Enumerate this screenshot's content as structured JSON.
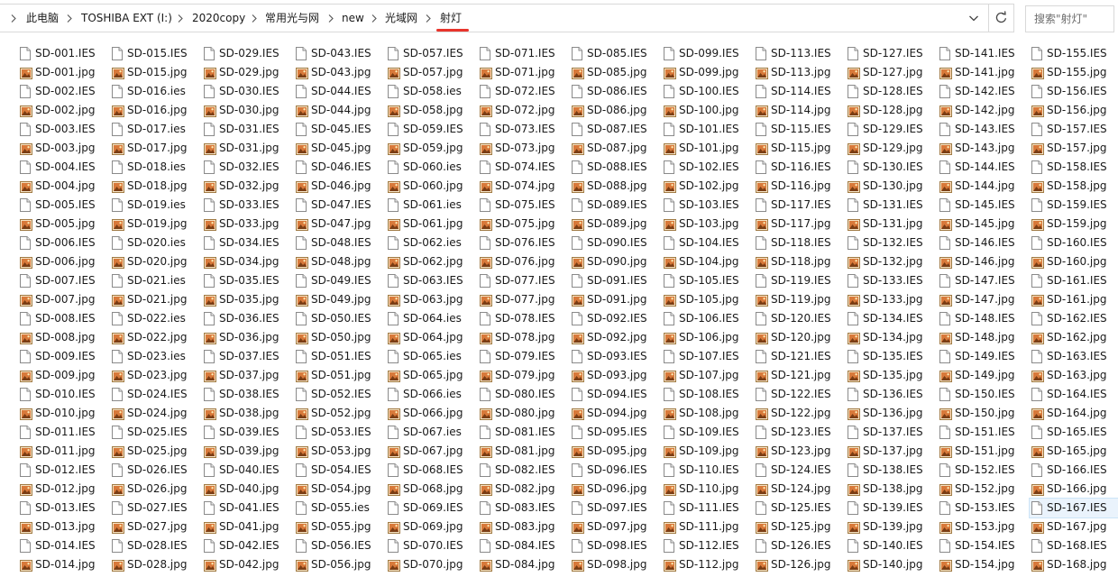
{
  "address_bar": {
    "breadcrumbs": [
      "此电脑",
      "TOSHIBA EXT (I:)",
      "2020copy",
      "常用光与网",
      "new",
      "光域网",
      "射灯"
    ]
  },
  "search": {
    "placeholder": "搜索\"射灯\""
  },
  "icons": {
    "address_dropdown": "chevron-down-icon",
    "refresh": "refresh-icon",
    "ies_file": "generic-file-icon",
    "jpg_file": "image-file-icon"
  },
  "colors": {
    "accent_underline": "#e8342c",
    "selection": "#eaf3fc"
  },
  "selected_file": "SD-167.IES",
  "files": {
    "columns": [
      [
        "SD-001.IES",
        "SD-001.jpg",
        "SD-002.IES",
        "SD-002.jpg",
        "SD-003.IES",
        "SD-003.jpg",
        "SD-004.IES",
        "SD-004.jpg",
        "SD-005.IES",
        "SD-005.jpg",
        "SD-006.IES",
        "SD-006.jpg",
        "SD-007.IES",
        "SD-007.jpg",
        "SD-008.IES",
        "SD-008.jpg",
        "SD-009.IES",
        "SD-009.jpg",
        "SD-010.IES",
        "SD-010.jpg",
        "SD-011.IES",
        "SD-011.jpg",
        "SD-012.IES",
        "SD-012.jpg",
        "SD-013.IES",
        "SD-013.jpg",
        "SD-014.IES",
        "SD-014.jpg"
      ],
      [
        "SD-015.IES",
        "SD-015.jpg",
        "SD-016.ies",
        "SD-016.jpg",
        "SD-017.ies",
        "SD-017.jpg",
        "SD-018.ies",
        "SD-018.jpg",
        "SD-019.ies",
        "SD-019.jpg",
        "SD-020.ies",
        "SD-020.jpg",
        "SD-021.ies",
        "SD-021.jpg",
        "SD-022.ies",
        "SD-022.jpg",
        "SD-023.ies",
        "SD-023.jpg",
        "SD-024.IES",
        "SD-024.jpg",
        "SD-025.IES",
        "SD-025.jpg",
        "SD-026.IES",
        "SD-026.jpg",
        "SD-027.IES",
        "SD-027.jpg",
        "SD-028.IES",
        "SD-028.jpg"
      ],
      [
        "SD-029.IES",
        "SD-029.jpg",
        "SD-030.IES",
        "SD-030.jpg",
        "SD-031.IES",
        "SD-031.jpg",
        "SD-032.IES",
        "SD-032.jpg",
        "SD-033.IES",
        "SD-033.jpg",
        "SD-034.IES",
        "SD-034.jpg",
        "SD-035.IES",
        "SD-035.jpg",
        "SD-036.IES",
        "SD-036.jpg",
        "SD-037.IES",
        "SD-037.jpg",
        "SD-038.IES",
        "SD-038.jpg",
        "SD-039.IES",
        "SD-039.jpg",
        "SD-040.IES",
        "SD-040.jpg",
        "SD-041.IES",
        "SD-041.jpg",
        "SD-042.IES",
        "SD-042.jpg"
      ],
      [
        "SD-043.IES",
        "SD-043.jpg",
        "SD-044.IES",
        "SD-044.jpg",
        "SD-045.IES",
        "SD-045.jpg",
        "SD-046.IES",
        "SD-046.jpg",
        "SD-047.IES",
        "SD-047.jpg",
        "SD-048.IES",
        "SD-048.jpg",
        "SD-049.IES",
        "SD-049.jpg",
        "SD-050.IES",
        "SD-050.jpg",
        "SD-051.IES",
        "SD-051.jpg",
        "SD-052.IES",
        "SD-052.jpg",
        "SD-053.IES",
        "SD-053.jpg",
        "SD-054.IES",
        "SD-054.jpg",
        "SD-055.ies",
        "SD-055.jpg",
        "SD-056.IES",
        "SD-056.jpg"
      ],
      [
        "SD-057.IES",
        "SD-057.jpg",
        "SD-058.ies",
        "SD-058.jpg",
        "SD-059.IES",
        "SD-059.jpg",
        "SD-060.ies",
        "SD-060.jpg",
        "SD-061.ies",
        "SD-061.jpg",
        "SD-062.ies",
        "SD-062.jpg",
        "SD-063.IES",
        "SD-063.jpg",
        "SD-064.ies",
        "SD-064.jpg",
        "SD-065.ies",
        "SD-065.jpg",
        "SD-066.ies",
        "SD-066.jpg",
        "SD-067.ies",
        "SD-067.jpg",
        "SD-068.IES",
        "SD-068.jpg",
        "SD-069.IES",
        "SD-069.jpg",
        "SD-070.IES",
        "SD-070.jpg"
      ],
      [
        "SD-071.IES",
        "SD-071.jpg",
        "SD-072.IES",
        "SD-072.jpg",
        "SD-073.IES",
        "SD-073.jpg",
        "SD-074.IES",
        "SD-074.jpg",
        "SD-075.IES",
        "SD-075.jpg",
        "SD-076.IES",
        "SD-076.jpg",
        "SD-077.IES",
        "SD-077.jpg",
        "SD-078.IES",
        "SD-078.jpg",
        "SD-079.IES",
        "SD-079.jpg",
        "SD-080.IES",
        "SD-080.jpg",
        "SD-081.IES",
        "SD-081.jpg",
        "SD-082.IES",
        "SD-082.jpg",
        "SD-083.IES",
        "SD-083.jpg",
        "SD-084.IES",
        "SD-084.jpg"
      ],
      [
        "SD-085.IES",
        "SD-085.jpg",
        "SD-086.IES",
        "SD-086.jpg",
        "SD-087.IES",
        "SD-087.jpg",
        "SD-088.IES",
        "SD-088.jpg",
        "SD-089.IES",
        "SD-089.jpg",
        "SD-090.IES",
        "SD-090.jpg",
        "SD-091.IES",
        "SD-091.jpg",
        "SD-092.IES",
        "SD-092.jpg",
        "SD-093.IES",
        "SD-093.jpg",
        "SD-094.IES",
        "SD-094.jpg",
        "SD-095.IES",
        "SD-095.jpg",
        "SD-096.IES",
        "SD-096.jpg",
        "SD-097.IES",
        "SD-097.jpg",
        "SD-098.IES",
        "SD-098.jpg"
      ],
      [
        "SD-099.IES",
        "SD-099.jpg",
        "SD-100.IES",
        "SD-100.jpg",
        "SD-101.IES",
        "SD-101.jpg",
        "SD-102.IES",
        "SD-102.jpg",
        "SD-103.IES",
        "SD-103.jpg",
        "SD-104.IES",
        "SD-104.jpg",
        "SD-105.IES",
        "SD-105.jpg",
        "SD-106.IES",
        "SD-106.jpg",
        "SD-107.IES",
        "SD-107.jpg",
        "SD-108.IES",
        "SD-108.jpg",
        "SD-109.IES",
        "SD-109.jpg",
        "SD-110.IES",
        "SD-110.jpg",
        "SD-111.IES",
        "SD-111.jpg",
        "SD-112.IES",
        "SD-112.jpg"
      ],
      [
        "SD-113.IES",
        "SD-113.jpg",
        "SD-114.IES",
        "SD-114.jpg",
        "SD-115.IES",
        "SD-115.jpg",
        "SD-116.IES",
        "SD-116.jpg",
        "SD-117.IES",
        "SD-117.jpg",
        "SD-118.IES",
        "SD-118.jpg",
        "SD-119.IES",
        "SD-119.jpg",
        "SD-120.IES",
        "SD-120.jpg",
        "SD-121.IES",
        "SD-121.jpg",
        "SD-122.IES",
        "SD-122.jpg",
        "SD-123.IES",
        "SD-123.jpg",
        "SD-124.IES",
        "SD-124.jpg",
        "SD-125.IES",
        "SD-125.jpg",
        "SD-126.IES",
        "SD-126.jpg"
      ],
      [
        "SD-127.IES",
        "SD-127.jpg",
        "SD-128.IES",
        "SD-128.jpg",
        "SD-129.IES",
        "SD-129.jpg",
        "SD-130.IES",
        "SD-130.jpg",
        "SD-131.IES",
        "SD-131.jpg",
        "SD-132.IES",
        "SD-132.jpg",
        "SD-133.IES",
        "SD-133.jpg",
        "SD-134.IES",
        "SD-134.jpg",
        "SD-135.IES",
        "SD-135.jpg",
        "SD-136.IES",
        "SD-136.jpg",
        "SD-137.IES",
        "SD-137.jpg",
        "SD-138.IES",
        "SD-138.jpg",
        "SD-139.IES",
        "SD-139.jpg",
        "SD-140.IES",
        "SD-140.jpg"
      ],
      [
        "SD-141.IES",
        "SD-141.jpg",
        "SD-142.IES",
        "SD-142.jpg",
        "SD-143.IES",
        "SD-143.jpg",
        "SD-144.IES",
        "SD-144.jpg",
        "SD-145.IES",
        "SD-145.jpg",
        "SD-146.IES",
        "SD-146.jpg",
        "SD-147.IES",
        "SD-147.jpg",
        "SD-148.IES",
        "SD-148.jpg",
        "SD-149.IES",
        "SD-149.jpg",
        "SD-150.IES",
        "SD-150.jpg",
        "SD-151.IES",
        "SD-151.jpg",
        "SD-152.IES",
        "SD-152.jpg",
        "SD-153.IES",
        "SD-153.jpg",
        "SD-154.IES",
        "SD-154.jpg"
      ],
      [
        "SD-155.IES",
        "SD-155.jpg",
        "SD-156.IES",
        "SD-156.jpg",
        "SD-157.IES",
        "SD-157.jpg",
        "SD-158.IES",
        "SD-158.jpg",
        "SD-159.IES",
        "SD-159.jpg",
        "SD-160.IES",
        "SD-160.jpg",
        "SD-161.IES",
        "SD-161.jpg",
        "SD-162.IES",
        "SD-162.jpg",
        "SD-163.IES",
        "SD-163.jpg",
        "SD-164.IES",
        "SD-164.jpg",
        "SD-165.IES",
        "SD-165.jpg",
        "SD-166.IES",
        "SD-166.jpg",
        "SD-167.IES",
        "SD-167.jpg",
        "SD-168.IES",
        "SD-168.jpg"
      ]
    ]
  }
}
